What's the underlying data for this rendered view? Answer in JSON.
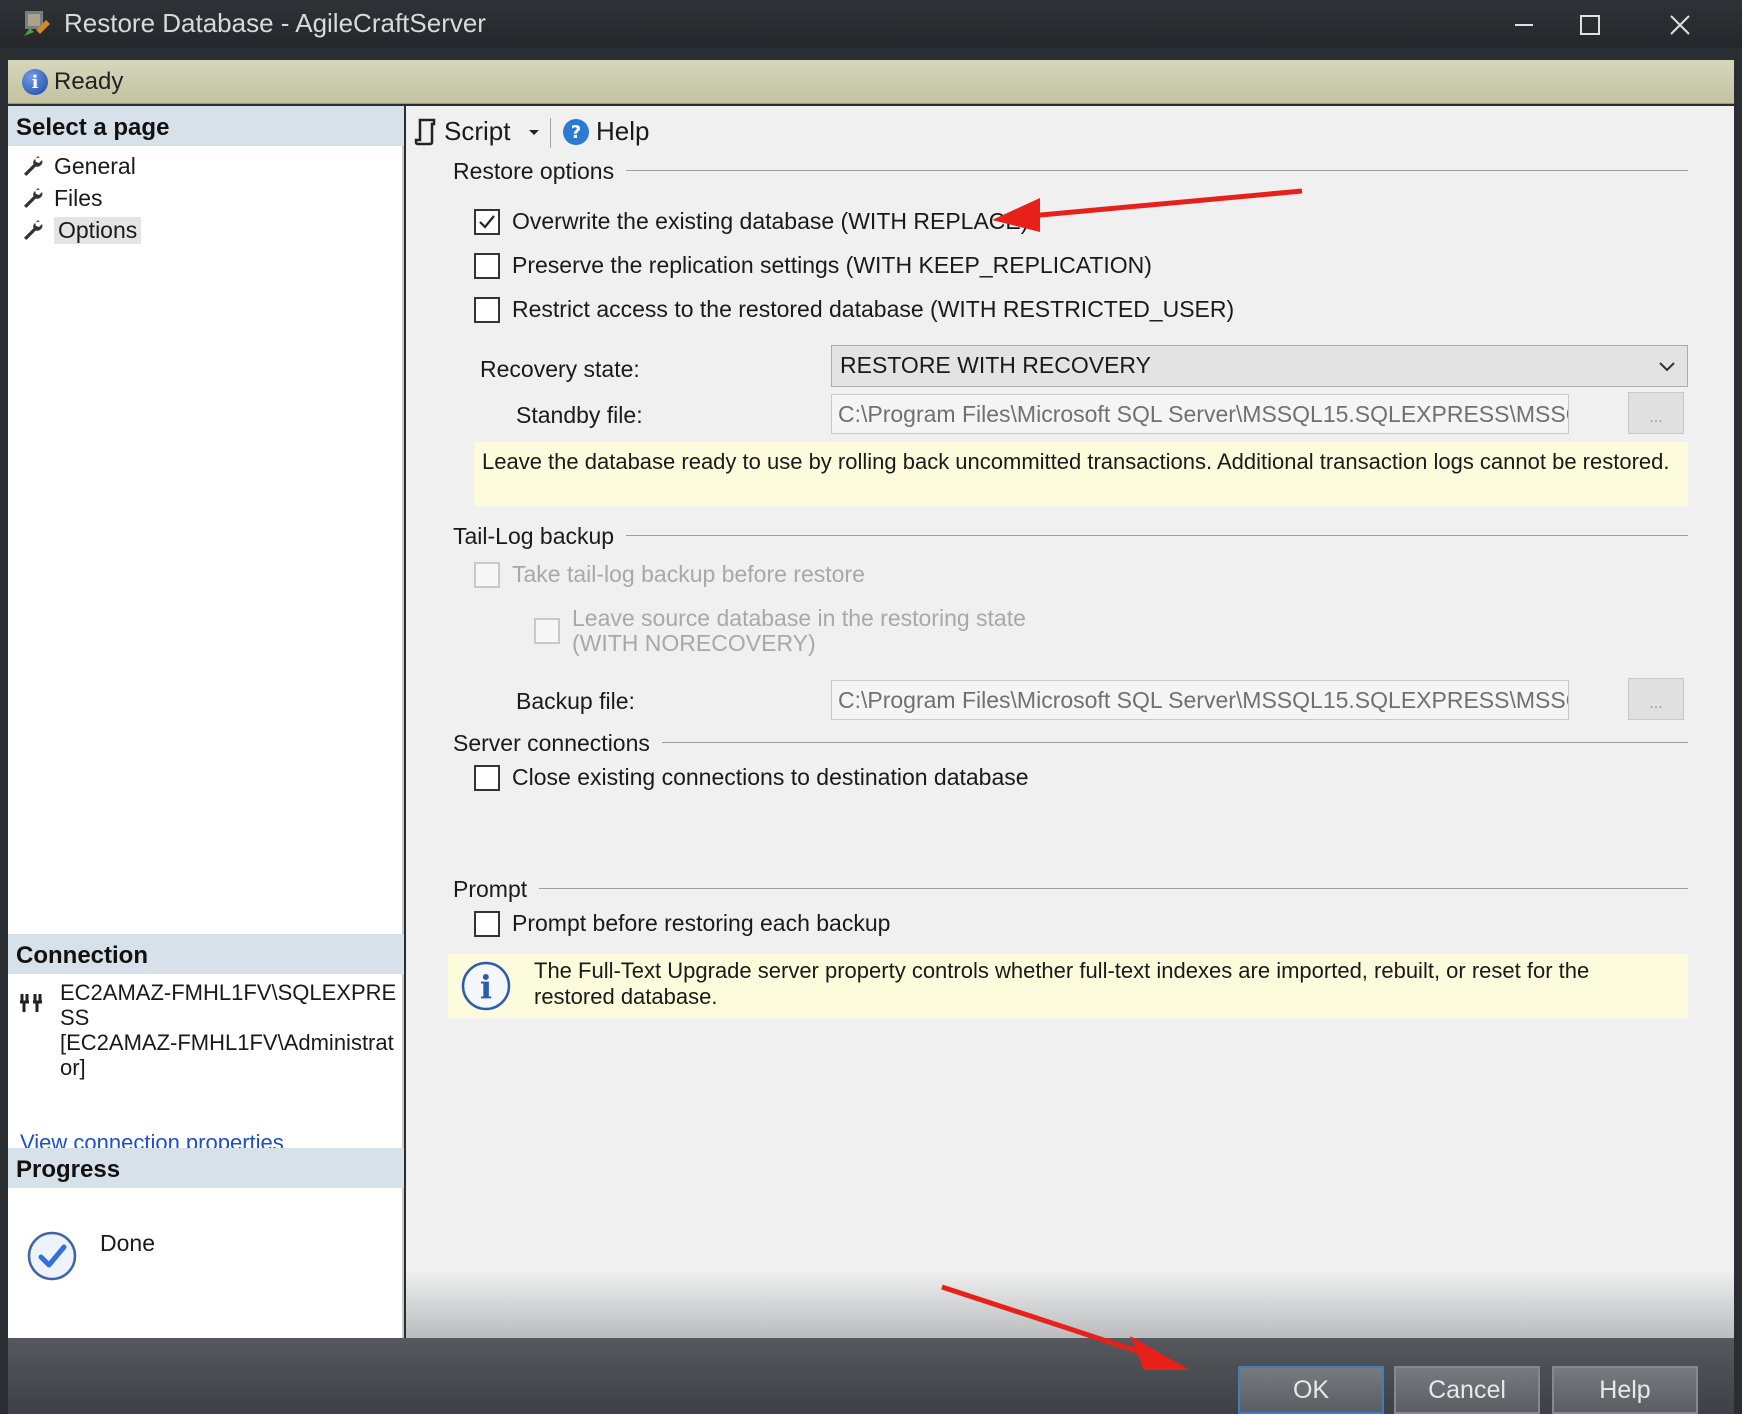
{
  "window": {
    "title": "Restore Database - AgileCraftServer",
    "minimize_icon": "minimize-icon",
    "maximize_icon": "maximize-icon",
    "close_icon": "close-icon"
  },
  "status": {
    "text": "Ready",
    "icon": "info-icon"
  },
  "left": {
    "select_page_heading": "Select a page",
    "pages": [
      {
        "label": "General",
        "icon": "wrench-icon"
      },
      {
        "label": "Files",
        "icon": "wrench-icon"
      },
      {
        "label": "Options",
        "icon": "wrench-icon",
        "selected": true
      }
    ],
    "connection_heading": "Connection",
    "connection_lines": [
      "EC2AMAZ-FMHL1FV\\SQLEXPRE",
      "SS",
      "[EC2AMAZ-FMHL1FV\\Administrat",
      "or]"
    ],
    "view_connection_link": "View connection properties",
    "progress_heading": "Progress",
    "progress_text": "Done"
  },
  "toolbar": {
    "script_label": "Script",
    "help_label": "Help"
  },
  "restore_options": {
    "title": "Restore options",
    "overwrite": {
      "label": "Overwrite the existing database (WITH REPLACE)",
      "checked": true
    },
    "preserve_replication": {
      "label": "Preserve the replication settings (WITH KEEP_REPLICATION)",
      "checked": false
    },
    "restrict_access": {
      "label": "Restrict access to the restored database (WITH RESTRICTED_USER)",
      "checked": false
    },
    "recovery_state_label": "Recovery state:",
    "recovery_state_value": "RESTORE WITH RECOVERY",
    "standby_file_label": "Standby file:",
    "standby_file_value": "C:\\Program Files\\Microsoft SQL Server\\MSSQL15.SQLEXPRESS\\MSSQL\\E",
    "browse_label": "...",
    "recovery_note": "Leave the database ready to use by rolling back uncommitted transactions. Additional transaction logs cannot be restored."
  },
  "tail_log": {
    "title": "Tail-Log backup",
    "take_backup": {
      "label": "Take tail-log backup before restore",
      "checked": false,
      "enabled": false
    },
    "leave_restoring": {
      "label_line1": "Leave source database in the restoring state",
      "label_line2": "(WITH NORECOVERY)",
      "checked": false,
      "enabled": false
    },
    "backup_file_label": "Backup file:",
    "backup_file_value": "C:\\Program Files\\Microsoft SQL Server\\MSSQL15.SQLEXPRESS\\MSSQL\\E",
    "browse_label": "..."
  },
  "server_connections": {
    "title": "Server connections",
    "close_existing": {
      "label": "Close existing connections to destination database",
      "checked": false
    }
  },
  "prompt": {
    "title": "Prompt",
    "prompt_before": {
      "label": "Prompt before restoring each backup",
      "checked": false
    },
    "info_note": "The Full-Text Upgrade server property controls whether full-text indexes are imported, rebuilt, or reset for the restored database."
  },
  "buttons": {
    "ok": "OK",
    "cancel": "Cancel",
    "help": "Help"
  },
  "colors": {
    "annotation_arrow": "#e8201a",
    "link": "#1a4fd0",
    "note_bg": "#fcfcdc"
  }
}
